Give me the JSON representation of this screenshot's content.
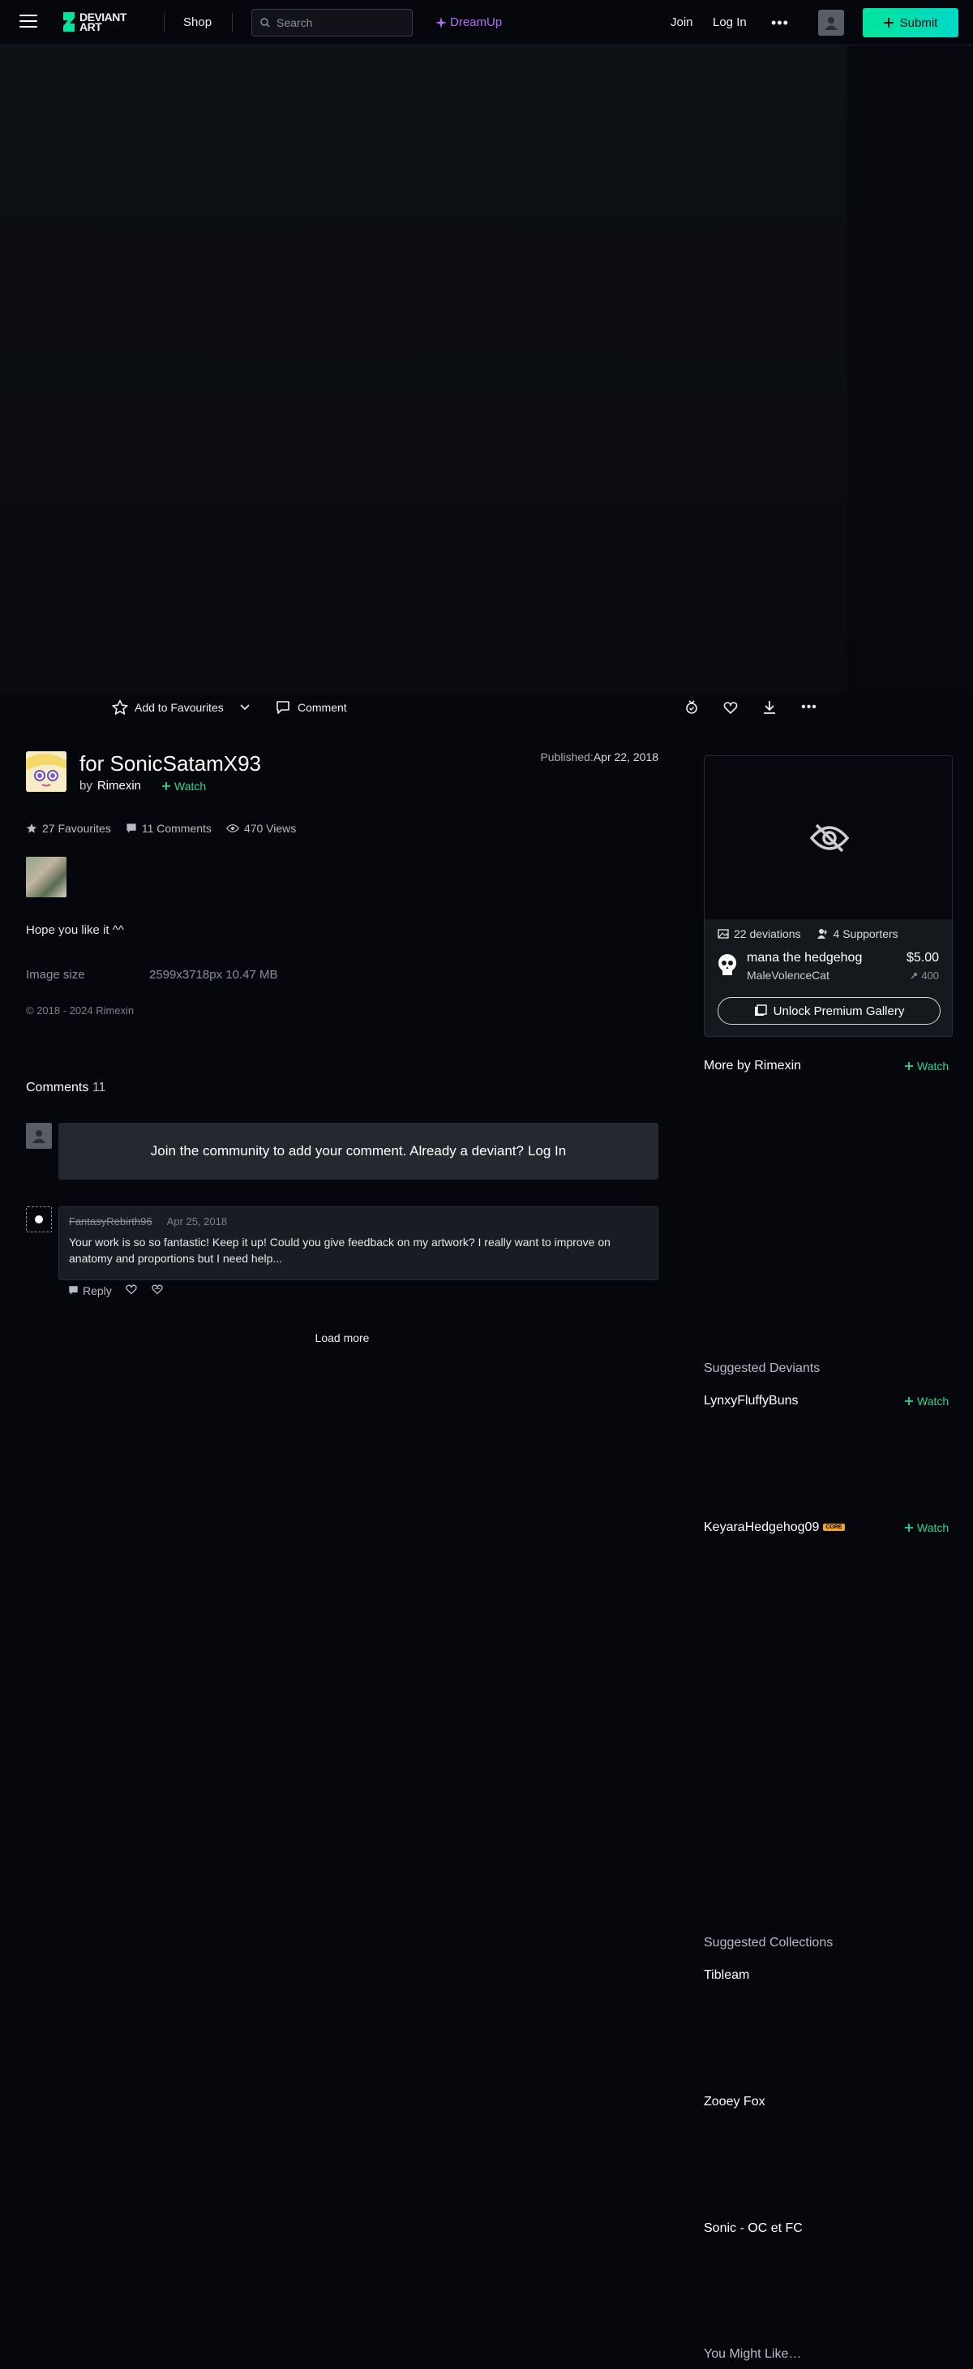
{
  "header": {
    "shop": "Shop",
    "search_placeholder": "Search",
    "dreamup": "DreamUp",
    "join": "Join",
    "login": "Log In",
    "submit": "Submit",
    "logo_line1": "DEVIANT",
    "logo_line2": "ART"
  },
  "action_bar": {
    "add_favourites": "Add to Favourites",
    "comment": "Comment"
  },
  "deviation": {
    "title": "for SonicSatamX93",
    "by": "by",
    "author": "Rimexin",
    "watch": "Watch",
    "published_label": "Published:",
    "published_date": "Apr 22, 2018",
    "favourites": "27 Favourites",
    "comments": "11 Comments",
    "views": "470 Views",
    "description": "Hope you like it ^^",
    "image_size_label": "Image size",
    "image_size_value": "2599x3718px 10.47 MB",
    "copyright": "© 2018 - 2024 Rimexin"
  },
  "comments": {
    "heading": "Comments",
    "count": "11",
    "join_prompt": "Join the community to add your comment. Already a deviant?",
    "login_link": "Log In",
    "items": [
      {
        "user": "FantasyRebirth96",
        "date": "Apr 25, 2018",
        "text": "Your work is so so fantastic! Keep it up! Could you give feedback on my artwork? I really want to improve on anatomy and proportions but I need help...",
        "reply": "Reply"
      }
    ],
    "load_more": "Load more"
  },
  "sidebar": {
    "premium": {
      "deviations": "22 deviations",
      "supporters": "4 Supporters",
      "name": "mana the hedgehog",
      "user": "MaleVolenceCat",
      "price": "$5.00",
      "points": "400",
      "unlock": "Unlock Premium Gallery"
    },
    "more_by": "More by Rimexin",
    "watch": "Watch",
    "suggested_deviants": "Suggested Deviants",
    "deviants": [
      {
        "name": "LynxyFluffyBuns"
      },
      {
        "name": "KeyaraHedgehog09",
        "badge": "CORE"
      }
    ],
    "suggested_collections": "Suggested Collections",
    "collections": [
      "Tibleam",
      "Zooey Fox",
      "Sonic - OC et FC"
    ],
    "you_might_like": "You Might Like…"
  },
  "colors": {
    "accent_green": "#2ed592",
    "submit_gradient_start": "#00e59b",
    "dreamup_purple": "#b46cf5"
  }
}
